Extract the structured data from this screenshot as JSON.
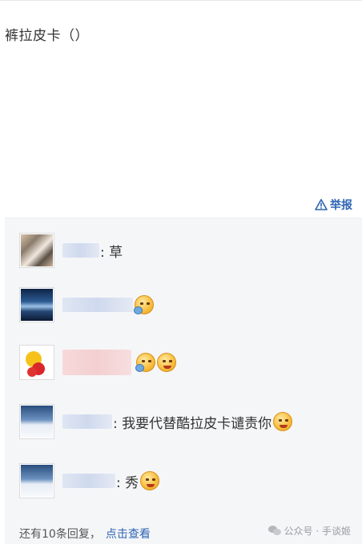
{
  "post": {
    "text": "裤拉皮卡（）"
  },
  "report": {
    "label": "举报",
    "icon": "warning-triangle-icon",
    "color": "#2d64b3"
  },
  "replies": [
    {
      "avatar": "group-photo",
      "text": ": 草",
      "emojis": []
    },
    {
      "avatar": "sea-horizon",
      "text": "",
      "emojis": [
        "emoji-face-icon"
      ]
    },
    {
      "avatar": "boxer-cartoon",
      "text": "",
      "emojis": [
        "emoji-face-icon",
        "emoji-face-icon"
      ]
    },
    {
      "avatar": "snow-mountain",
      "text": ": 我要代替酷拉皮卡谴责你",
      "emojis": [
        "emoji-face-icon"
      ]
    },
    {
      "avatar": "snow-mountain",
      "text": ": 秀",
      "emojis": [
        "emoji-face-icon"
      ]
    }
  ],
  "footer": {
    "more_text": "还有10条回复，",
    "more_link": "点击查看"
  },
  "watermark": {
    "text": "公众号 · 手谈姬"
  }
}
